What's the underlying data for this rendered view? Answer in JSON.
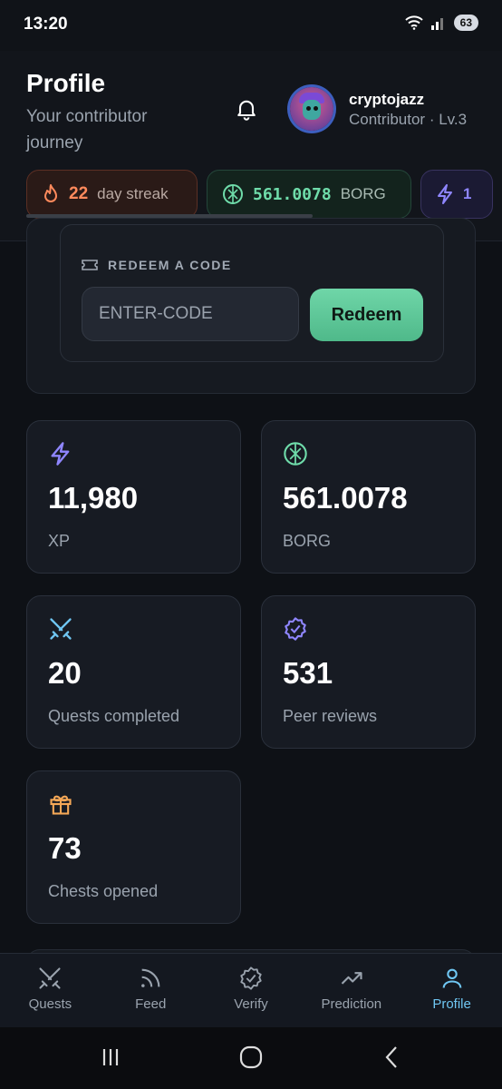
{
  "status": {
    "time": "13:20",
    "battery": "63"
  },
  "header": {
    "title": "Profile",
    "subtitle": "Your contributor journey",
    "username": "cryptojazz",
    "role": "Contributor · Lv.3"
  },
  "chips": {
    "streak_value": "22",
    "streak_label": "day streak",
    "borg_value": "561.0078",
    "borg_label": "BORG",
    "xp_value": "1"
  },
  "redeem": {
    "label": "REDEEM A CODE",
    "placeholder": "ENTER-CODE",
    "button": "Redeem"
  },
  "stats": [
    {
      "value": "11,980",
      "label": "XP"
    },
    {
      "value": "561.0078",
      "label": "BORG"
    },
    {
      "value": "20",
      "label": "Quests completed"
    },
    {
      "value": "531",
      "label": "Peer reviews"
    },
    {
      "value": "73",
      "label": "Chests opened"
    }
  ],
  "nav": [
    {
      "label": "Quests"
    },
    {
      "label": "Feed"
    },
    {
      "label": "Verify"
    },
    {
      "label": "Prediction"
    },
    {
      "label": "Profile"
    }
  ],
  "colors": {
    "accent": "#6fc6f2",
    "borg": "#6fdcaa",
    "xp": "#8f86ff",
    "streak": "#ff8a5c"
  }
}
